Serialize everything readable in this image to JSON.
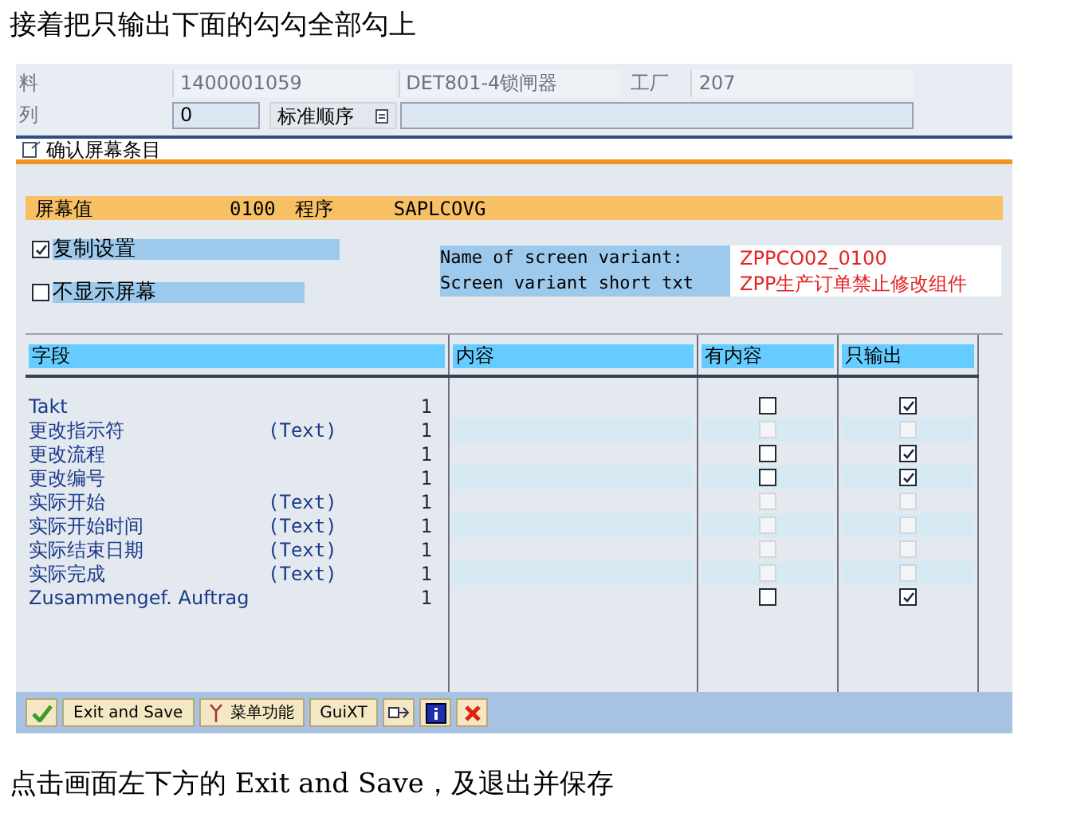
{
  "intro": "接着把只输出下面的勾勾全部勾上",
  "header_rows": [
    {
      "label": "料",
      "fields": [
        {
          "kind": "readonly",
          "value": "1400001059"
        },
        {
          "kind": "readonly",
          "value": "DET801-4锁闸器"
        },
        {
          "kind": "label",
          "value": "工厂"
        },
        {
          "kind": "readonly",
          "value": "207"
        }
      ]
    },
    {
      "label": "列",
      "fields": [
        {
          "kind": "input",
          "value": "0"
        },
        {
          "kind": "select",
          "value": "标准顺序"
        },
        {
          "kind": "empty"
        }
      ]
    }
  ],
  "title": "确认屏幕条目",
  "screen_bar": {
    "label": "屏幕值",
    "number": "0100",
    "program_label": "程序",
    "program": "SAPLCOVG"
  },
  "options": [
    {
      "label": "复制设置",
      "checked": true
    },
    {
      "label": "不显示屏幕",
      "checked": false
    }
  ],
  "variant": [
    {
      "label": "Name of screen variant:",
      "value": "ZPPCO02_0100"
    },
    {
      "label": "Screen variant short txt",
      "value": "ZPP生产订单禁止修改组件"
    }
  ],
  "table": {
    "columns": [
      "字段",
      "内容",
      "有内容",
      "只输出"
    ],
    "rows": [
      {
        "field": "Takt",
        "suffix": "",
        "count": "1",
        "has_content": {
          "checked": false,
          "disabled": false
        },
        "output_only": {
          "checked": true,
          "disabled": false
        }
      },
      {
        "field": "更改指示符",
        "suffix": "(Text)",
        "count": "1",
        "has_content": {
          "checked": false,
          "disabled": true
        },
        "output_only": {
          "checked": false,
          "disabled": true
        }
      },
      {
        "field": "更改流程",
        "suffix": "",
        "count": "1",
        "has_content": {
          "checked": false,
          "disabled": false
        },
        "output_only": {
          "checked": true,
          "disabled": false
        }
      },
      {
        "field": "更改编号",
        "suffix": "",
        "count": "1",
        "has_content": {
          "checked": false,
          "disabled": false
        },
        "output_only": {
          "checked": true,
          "disabled": false
        }
      },
      {
        "field": "实际开始",
        "suffix": "(Text)",
        "count": "1",
        "has_content": {
          "checked": false,
          "disabled": true
        },
        "output_only": {
          "checked": false,
          "disabled": true
        }
      },
      {
        "field": "实际开始时间",
        "suffix": "(Text)",
        "count": "1",
        "has_content": {
          "checked": false,
          "disabled": true
        },
        "output_only": {
          "checked": false,
          "disabled": true
        }
      },
      {
        "field": "实际结束日期",
        "suffix": "(Text)",
        "count": "1",
        "has_content": {
          "checked": false,
          "disabled": true
        },
        "output_only": {
          "checked": false,
          "disabled": true
        }
      },
      {
        "field": "实际完成",
        "suffix": "(Text)",
        "count": "1",
        "has_content": {
          "checked": false,
          "disabled": true
        },
        "output_only": {
          "checked": false,
          "disabled": true
        }
      },
      {
        "field": "Zusammengef. Auftrag",
        "suffix": "",
        "count": "1",
        "has_content": {
          "checked": false,
          "disabled": false
        },
        "output_only": {
          "checked": true,
          "disabled": false
        }
      }
    ]
  },
  "toolbar": [
    {
      "kind": "check"
    },
    {
      "kind": "text",
      "label": "Exit and Save"
    },
    {
      "kind": "menu",
      "label": "菜单功能"
    },
    {
      "kind": "text",
      "label": "GuiXT"
    },
    {
      "kind": "transfer"
    },
    {
      "kind": "info"
    },
    {
      "kind": "cancel"
    }
  ],
  "outro": "点击画面左下方的 Exit and Save，及退出并保存"
}
